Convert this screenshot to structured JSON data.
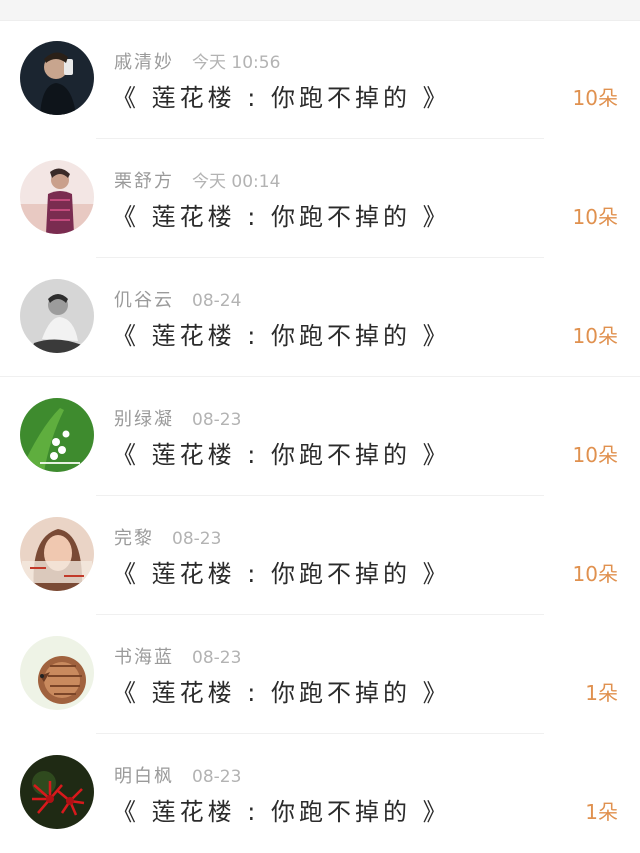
{
  "gifts": [
    {
      "user": "戚清妙",
      "time": "今天 10:56",
      "title": "《 莲花楼 : 你跑不掉的 》",
      "count": "10朵"
    },
    {
      "user": "栗舒方",
      "time": "今天 00:14",
      "title": "《 莲花楼 : 你跑不掉的 》",
      "count": "10朵"
    },
    {
      "user": "仉谷云",
      "time": "08-24",
      "title": "《 莲花楼 : 你跑不掉的 》",
      "count": "10朵"
    },
    {
      "user": "别绿凝",
      "time": "08-23",
      "title": "《 莲花楼 : 你跑不掉的 》",
      "count": "10朵"
    },
    {
      "user": "完黎",
      "time": "08-23",
      "title": "《 莲花楼 : 你跑不掉的 》",
      "count": "10朵"
    },
    {
      "user": "书海蓝",
      "time": "08-23",
      "title": "《 莲花楼 : 你跑不掉的 》",
      "count": "1朵"
    },
    {
      "user": "明白枫",
      "time": "08-23",
      "title": "《 莲花楼 : 你跑不掉的 》",
      "count": "1朵"
    }
  ],
  "colors": {
    "accent": "#e0914f",
    "name": "#9a9a9a",
    "title": "#2b2b2b"
  }
}
